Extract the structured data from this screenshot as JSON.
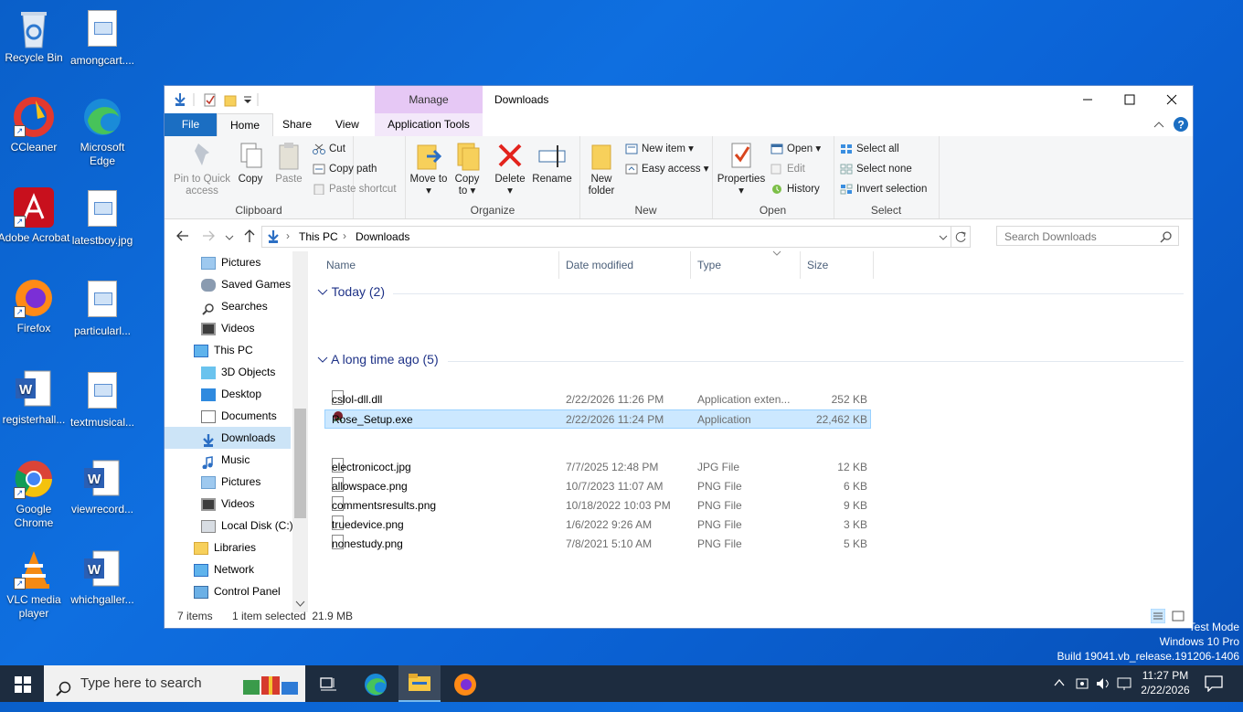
{
  "desktop_icons": [
    {
      "label": "Recycle Bin",
      "icon": "recycle-bin-icon"
    },
    {
      "label": "amongcart....",
      "icon": "image-file-icon"
    },
    {
      "label": "CCleaner",
      "icon": "ccleaner-icon"
    },
    {
      "label": "Microsoft Edge",
      "icon": "edge-icon"
    },
    {
      "label": "Adobe Acrobat",
      "icon": "acrobat-icon"
    },
    {
      "label": "latestboy.jpg",
      "icon": "image-file-icon"
    },
    {
      "label": "Firefox",
      "icon": "firefox-icon"
    },
    {
      "label": "particularl...",
      "icon": "image-file-icon"
    },
    {
      "label": "registerhall...",
      "icon": "word-doc-icon"
    },
    {
      "label": "textmusical...",
      "icon": "image-file-icon"
    },
    {
      "label": "Google Chrome",
      "icon": "chrome-icon"
    },
    {
      "label": "viewrecord...",
      "icon": "word-doc-icon"
    },
    {
      "label": "VLC media player",
      "icon": "vlc-icon"
    },
    {
      "label": "whichgaller...",
      "icon": "word-doc-icon"
    }
  ],
  "window": {
    "title": "Downloads",
    "context_tab_group": "Manage",
    "tabs": [
      "File",
      "Home",
      "Share",
      "View",
      "Application Tools"
    ],
    "active_tab": "Home"
  },
  "ribbon": {
    "clipboard": {
      "label": "Clipboard",
      "pin": "Pin to Quick access",
      "copy": "Copy",
      "paste": "Paste",
      "cut": "Cut",
      "copy_path": "Copy path",
      "paste_shortcut": "Paste shortcut"
    },
    "organize": {
      "label": "Organize",
      "move_to": "Move to",
      "copy_to": "Copy to",
      "delete": "Delete",
      "rename": "Rename"
    },
    "new": {
      "label": "New",
      "new_folder": "New folder",
      "new_item": "New item",
      "easy_access": "Easy access"
    },
    "open": {
      "label": "Open",
      "properties": "Properties",
      "open": "Open",
      "edit": "Edit",
      "history": "History"
    },
    "select": {
      "label": "Select",
      "select_all": "Select all",
      "select_none": "Select none",
      "invert": "Invert selection"
    }
  },
  "address": {
    "crumbs": [
      "This PC",
      "Downloads"
    ],
    "search_placeholder": "Search Downloads"
  },
  "nav_items": [
    {
      "label": "Pictures",
      "icon": "pictures-folder-icon",
      "indent": 1
    },
    {
      "label": "Saved Games",
      "icon": "saved-games-icon",
      "indent": 1
    },
    {
      "label": "Searches",
      "icon": "searches-icon",
      "indent": 1
    },
    {
      "label": "Videos",
      "icon": "videos-folder-icon",
      "indent": 1
    },
    {
      "label": "This PC",
      "icon": "this-pc-icon",
      "indent": 0
    },
    {
      "label": "3D Objects",
      "icon": "3d-objects-icon",
      "indent": 1
    },
    {
      "label": "Desktop",
      "icon": "desktop-folder-icon",
      "indent": 1
    },
    {
      "label": "Documents",
      "icon": "documents-folder-icon",
      "indent": 1
    },
    {
      "label": "Downloads",
      "icon": "downloads-folder-icon",
      "indent": 1,
      "selected": true
    },
    {
      "label": "Music",
      "icon": "music-folder-icon",
      "indent": 1
    },
    {
      "label": "Pictures",
      "icon": "pictures-folder-icon",
      "indent": 1
    },
    {
      "label": "Videos",
      "icon": "videos-folder-icon",
      "indent": 1
    },
    {
      "label": "Local Disk (C:)",
      "icon": "local-disk-icon",
      "indent": 1
    },
    {
      "label": "Libraries",
      "icon": "libraries-icon",
      "indent": 0
    },
    {
      "label": "Network",
      "icon": "network-icon",
      "indent": 0
    },
    {
      "label": "Control Panel",
      "icon": "control-panel-icon",
      "indent": 0
    }
  ],
  "columns": [
    "Name",
    "Date modified",
    "Type",
    "Size"
  ],
  "groups": [
    {
      "title": "Today (2)",
      "files": [
        {
          "name": "cslol-dll.dll",
          "date": "2/22/2026 11:26 PM",
          "type": "Application exten...",
          "size": "252 KB"
        },
        {
          "name": "Rose_Setup.exe",
          "date": "2/22/2026 11:24 PM",
          "type": "Application",
          "size": "22,462 KB",
          "selected": true
        }
      ]
    },
    {
      "title": "A long time ago (5)",
      "files": [
        {
          "name": "electronicoct.jpg",
          "date": "7/7/2025 12:48 PM",
          "type": "JPG File",
          "size": "12 KB"
        },
        {
          "name": "allowspace.png",
          "date": "10/7/2023 11:07 AM",
          "type": "PNG File",
          "size": "6 KB"
        },
        {
          "name": "commentsresults.png",
          "date": "10/18/2022 10:03 PM",
          "type": "PNG File",
          "size": "9 KB"
        },
        {
          "name": "truedevice.png",
          "date": "1/6/2022 9:26 AM",
          "type": "PNG File",
          "size": "3 KB"
        },
        {
          "name": "nonestudy.png",
          "date": "7/8/2021 5:10 AM",
          "type": "PNG File",
          "size": "5 KB"
        }
      ]
    }
  ],
  "status": {
    "count": "7 items",
    "selection": "1 item selected  21.9 MB"
  },
  "watermark": {
    "line1": "Test Mode",
    "line2": "Windows 10 Pro",
    "line3": "Build 19041.vb_release.191206-1406"
  },
  "taskbar": {
    "search_placeholder": "Type here to search",
    "time": "11:27 PM",
    "date": "2/22/2026"
  }
}
